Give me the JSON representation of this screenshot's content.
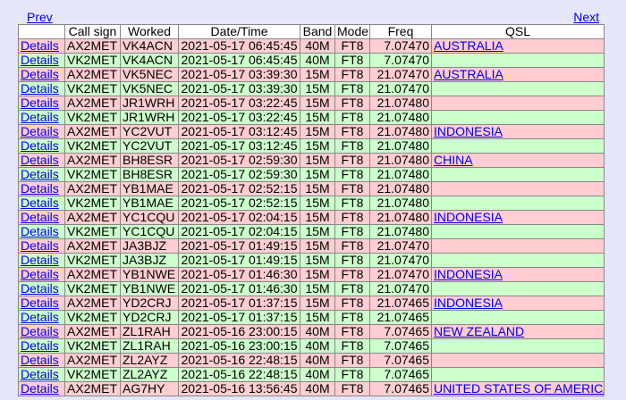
{
  "nav": {
    "prev": "Prev",
    "next": "Next"
  },
  "columns": [
    "",
    "Call sign",
    "Worked",
    "Date/Time",
    "Band",
    "Mode",
    "Freq",
    "QSL"
  ],
  "rows": [
    {
      "details": "Details",
      "call": "AX2MET",
      "worked": "VK4ACN",
      "dt": "2021-05-17 06:45:45",
      "band": "40M",
      "mode": "FT8",
      "freq": "7.07470",
      "qsl": "AUSTRALIA",
      "color": "pink"
    },
    {
      "details": "Details",
      "call": "VK2MET",
      "worked": "VK4ACN",
      "dt": "2021-05-17 06:45:45",
      "band": "40M",
      "mode": "FT8",
      "freq": "7.07470",
      "qsl": "",
      "color": "green"
    },
    {
      "details": "Details",
      "call": "AX2MET",
      "worked": "VK5NEC",
      "dt": "2021-05-17 03:39:30",
      "band": "15M",
      "mode": "FT8",
      "freq": "21.07470",
      "qsl": "AUSTRALIA",
      "color": "pink"
    },
    {
      "details": "Details",
      "call": "VK2MET",
      "worked": "VK5NEC",
      "dt": "2021-05-17 03:39:30",
      "band": "15M",
      "mode": "FT8",
      "freq": "21.07470",
      "qsl": "",
      "color": "green"
    },
    {
      "details": "Details",
      "call": "AX2MET",
      "worked": "JR1WRH",
      "dt": "2021-05-17 03:22:45",
      "band": "15M",
      "mode": "FT8",
      "freq": "21.07480",
      "qsl": "",
      "color": "pink"
    },
    {
      "details": "Details",
      "call": "VK2MET",
      "worked": "JR1WRH",
      "dt": "2021-05-17 03:22:45",
      "band": "15M",
      "mode": "FT8",
      "freq": "21.07480",
      "qsl": "",
      "color": "green"
    },
    {
      "details": "Details",
      "call": "AX2MET",
      "worked": "YC2VUT",
      "dt": "2021-05-17 03:12:45",
      "band": "15M",
      "mode": "FT8",
      "freq": "21.07480",
      "qsl": "INDONESIA",
      "color": "pink"
    },
    {
      "details": "Details",
      "call": "VK2MET",
      "worked": "YC2VUT",
      "dt": "2021-05-17 03:12:45",
      "band": "15M",
      "mode": "FT8",
      "freq": "21.07480",
      "qsl": "",
      "color": "green"
    },
    {
      "details": "Details",
      "call": "AX2MET",
      "worked": "BH8ESR",
      "dt": "2021-05-17 02:59:30",
      "band": "15M",
      "mode": "FT8",
      "freq": "21.07480",
      "qsl": "CHINA",
      "color": "pink"
    },
    {
      "details": "Details",
      "call": "VK2MET",
      "worked": "BH8ESR",
      "dt": "2021-05-17 02:59:30",
      "band": "15M",
      "mode": "FT8",
      "freq": "21.07480",
      "qsl": "",
      "color": "green"
    },
    {
      "details": "Details",
      "call": "AX2MET",
      "worked": "YB1MAE",
      "dt": "2021-05-17 02:52:15",
      "band": "15M",
      "mode": "FT8",
      "freq": "21.07480",
      "qsl": "",
      "color": "pink"
    },
    {
      "details": "Details",
      "call": "VK2MET",
      "worked": "YB1MAE",
      "dt": "2021-05-17 02:52:15",
      "band": "15M",
      "mode": "FT8",
      "freq": "21.07480",
      "qsl": "",
      "color": "green"
    },
    {
      "details": "Details",
      "call": "AX2MET",
      "worked": "YC1CQU",
      "dt": "2021-05-17 02:04:15",
      "band": "15M",
      "mode": "FT8",
      "freq": "21.07480",
      "qsl": "INDONESIA",
      "color": "pink"
    },
    {
      "details": "Details",
      "call": "VK2MET",
      "worked": "YC1CQU",
      "dt": "2021-05-17 02:04:15",
      "band": "15M",
      "mode": "FT8",
      "freq": "21.07480",
      "qsl": "",
      "color": "green"
    },
    {
      "details": "Details",
      "call": "AX2MET",
      "worked": "JA3BJZ",
      "dt": "2021-05-17 01:49:15",
      "band": "15M",
      "mode": "FT8",
      "freq": "21.07470",
      "qsl": "",
      "color": "pink"
    },
    {
      "details": "Details",
      "call": "VK2MET",
      "worked": "JA3BJZ",
      "dt": "2021-05-17 01:49:15",
      "band": "15M",
      "mode": "FT8",
      "freq": "21.07470",
      "qsl": "",
      "color": "green"
    },
    {
      "details": "Details",
      "call": "AX2MET",
      "worked": "YB1NWE",
      "dt": "2021-05-17 01:46:30",
      "band": "15M",
      "mode": "FT8",
      "freq": "21.07470",
      "qsl": "INDONESIA",
      "color": "pink"
    },
    {
      "details": "Details",
      "call": "VK2MET",
      "worked": "YB1NWE",
      "dt": "2021-05-17 01:46:30",
      "band": "15M",
      "mode": "FT8",
      "freq": "21.07470",
      "qsl": "",
      "color": "green"
    },
    {
      "details": "Details",
      "call": "AX2MET",
      "worked": "YD2CRJ",
      "dt": "2021-05-17 01:37:15",
      "band": "15M",
      "mode": "FT8",
      "freq": "21.07465",
      "qsl": "INDONESIA",
      "color": "pink"
    },
    {
      "details": "Details",
      "call": "VK2MET",
      "worked": "YD2CRJ",
      "dt": "2021-05-17 01:37:15",
      "band": "15M",
      "mode": "FT8",
      "freq": "21.07465",
      "qsl": "",
      "color": "green"
    },
    {
      "details": "Details",
      "call": "AX2MET",
      "worked": "ZL1RAH",
      "dt": "2021-05-16 23:00:15",
      "band": "40M",
      "mode": "FT8",
      "freq": "7.07465",
      "qsl": "NEW ZEALAND",
      "color": "pink"
    },
    {
      "details": "Details",
      "call": "VK2MET",
      "worked": "ZL1RAH",
      "dt": "2021-05-16 23:00:15",
      "band": "40M",
      "mode": "FT8",
      "freq": "7.07465",
      "qsl": "",
      "color": "green"
    },
    {
      "details": "Details",
      "call": "AX2MET",
      "worked": "ZL2AYZ",
      "dt": "2021-05-16 22:48:15",
      "band": "40M",
      "mode": "FT8",
      "freq": "7.07465",
      "qsl": "",
      "color": "pink"
    },
    {
      "details": "Details",
      "call": "VK2MET",
      "worked": "ZL2AYZ",
      "dt": "2021-05-16 22:48:15",
      "band": "40M",
      "mode": "FT8",
      "freq": "7.07465",
      "qsl": "",
      "color": "green"
    },
    {
      "details": "Details",
      "call": "AX2MET",
      "worked": "AG7HY",
      "dt": "2021-05-16 13:56:45",
      "band": "40M",
      "mode": "FT8",
      "freq": "7.07465",
      "qsl": "UNITED STATES OF AMERICA",
      "color": "pink"
    }
  ]
}
